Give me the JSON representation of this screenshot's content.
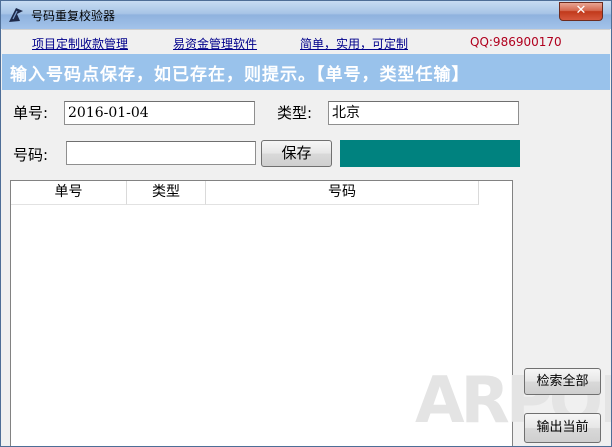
{
  "window": {
    "title": "号码重复校验器",
    "close_label": "✕"
  },
  "links": {
    "project": "项目定制收款管理",
    "finance": "易资金管理软件",
    "slogan": "简单，实用，可定制",
    "qq": "QQ:986900170"
  },
  "banner": {
    "text": "输入号码点保存，如已存在，则提示。【单号，类型任输】"
  },
  "form": {
    "order_label": "单号:",
    "order_value": "2016-01-04",
    "type_label": "类型:",
    "type_value": "北京",
    "number_label": "号码:",
    "number_value": "",
    "save_label": "保存",
    "status_color": "#00827f"
  },
  "table": {
    "columns": [
      "单号",
      "类型",
      "号码"
    ],
    "rows": []
  },
  "actions": {
    "search_all": "检索全部",
    "export_current": "输出当前"
  },
  "watermark": "ARPON"
}
